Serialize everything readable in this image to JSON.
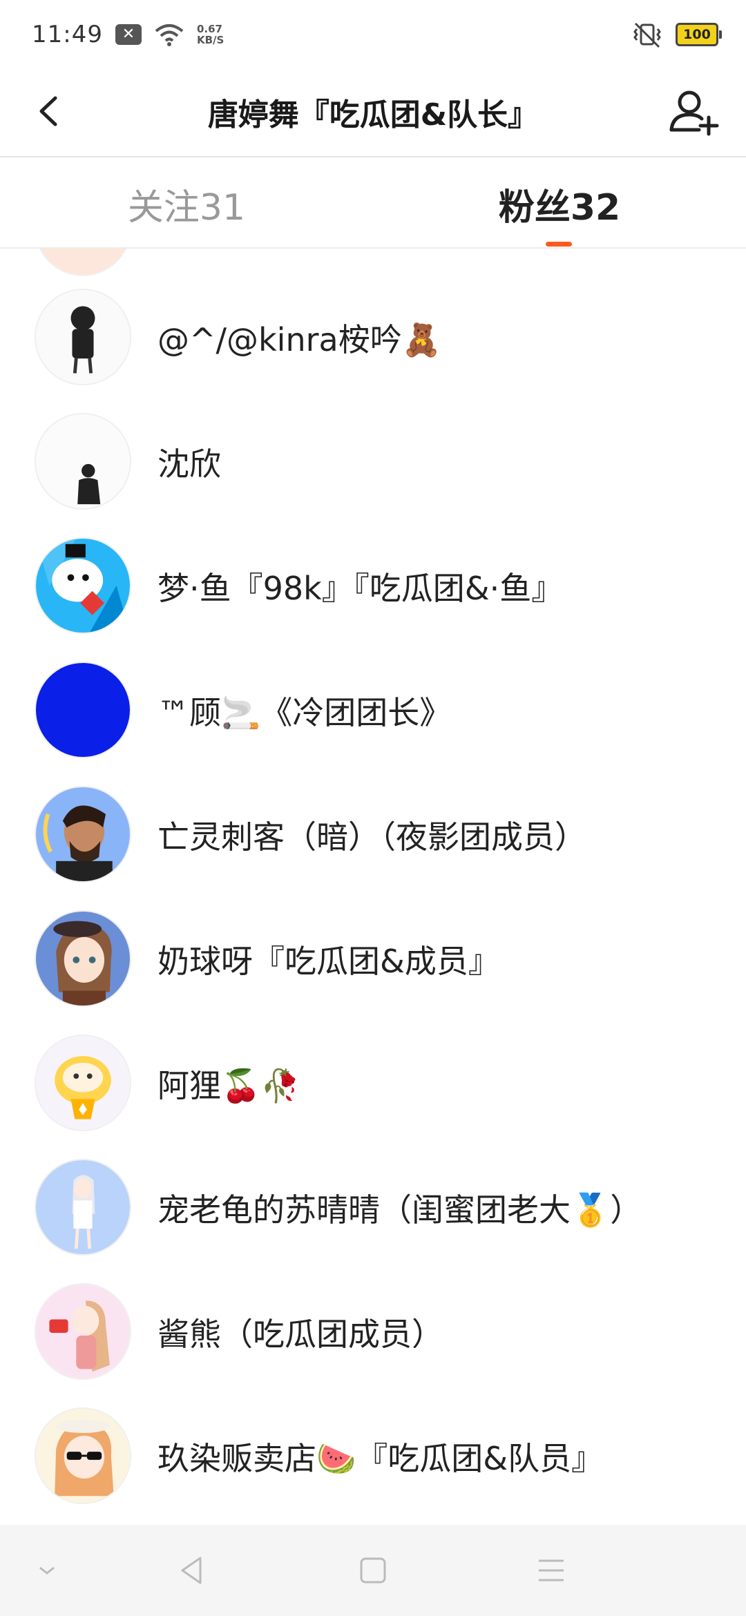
{
  "status_bar": {
    "time": "11:49",
    "notification_icon": "x-box-icon",
    "net_speed_value": "0.67",
    "net_speed_unit": "KB/S",
    "battery": "100"
  },
  "header": {
    "title": "唐婷舞『吃瓜团&队长』",
    "back_icon": "chevron-left-icon",
    "add_user_icon": "add-user-icon"
  },
  "tabs": [
    {
      "label": "关注31",
      "active": false
    },
    {
      "label": "粉丝32",
      "active": true
    }
  ],
  "accent_color": "#ff5a1f",
  "fans": [
    {
      "name": "@^/@kinra桉吟🧸"
    },
    {
      "name": "沈欣"
    },
    {
      "name": "梦·鱼『98k』『吃瓜团&·鱼』"
    },
    {
      "name": "™顾🚬《冷团团长》"
    },
    {
      "name": "亡灵刺客（暗）（夜影团成员）"
    },
    {
      "name": "奶球呀『吃瓜团&成员』"
    },
    {
      "name": "阿狸🍒🥀"
    },
    {
      "name": "宠老龟的苏晴晴（闺蜜团老大🥇）"
    },
    {
      "name": "酱熊（吃瓜团成员）"
    },
    {
      "name": "玖染贩卖店🍉『吃瓜团&队员』"
    }
  ],
  "nav_bar": {
    "buttons": [
      "collapse-icon",
      "back-triangle-icon",
      "home-square-icon",
      "menu-lines-icon"
    ]
  }
}
